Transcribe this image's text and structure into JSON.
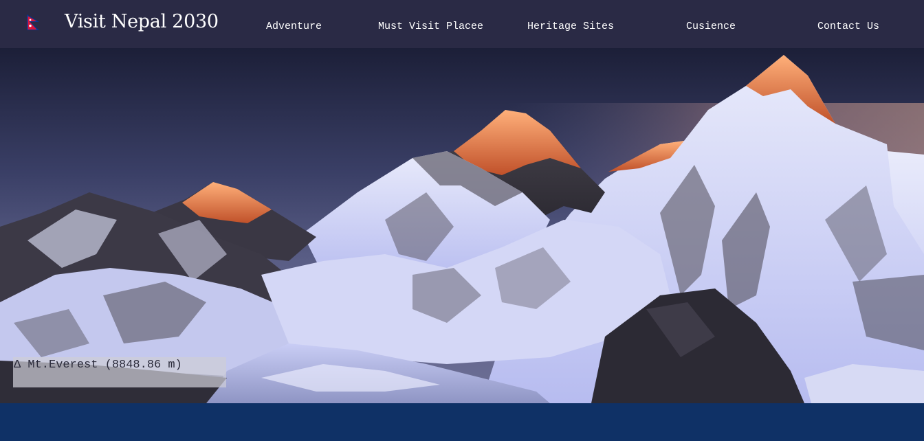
{
  "brand": {
    "title": "Visit Nepal 2030",
    "flag_icon": "nepal-flag-icon"
  },
  "nav": {
    "items": [
      {
        "label": "Adventure"
      },
      {
        "label": "Must Visit Placee"
      },
      {
        "label": "Heritage Sites"
      },
      {
        "label": "Cusience"
      },
      {
        "label": "Contact Us"
      }
    ]
  },
  "hero": {
    "caption": "Δ Mt.Everest (8848.86 m)"
  },
  "colors": {
    "navbar": "#2a2a45",
    "footer": "#0f3166",
    "flag_red": "#dc143c",
    "flag_blue": "#003893"
  }
}
